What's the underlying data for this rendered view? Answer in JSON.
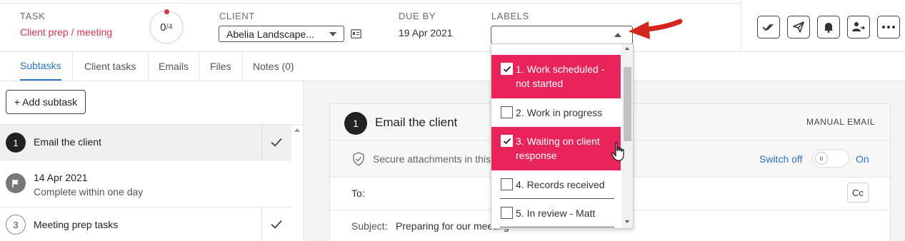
{
  "header": {
    "task_label": "TASK",
    "task_name": "Client prep / meeting",
    "progress_done": "0",
    "progress_total": "/4",
    "client_label": "CLIENT",
    "client_value": "Abelia Landscape...",
    "due_label": "DUE BY",
    "due_value": "19 Apr 2021",
    "labels_label": "LABELS"
  },
  "tabs": [
    {
      "label": "Subtasks",
      "active": true
    },
    {
      "label": "Client tasks"
    },
    {
      "label": "Emails"
    },
    {
      "label": "Files"
    },
    {
      "label": "Notes (0)"
    }
  ],
  "left": {
    "add_button": "+ Add subtask",
    "items": [
      {
        "num": "1",
        "title": "Email the client"
      },
      {
        "title": "14 Apr 2021",
        "desc": "Complete within one day"
      },
      {
        "num": "3",
        "title": "Meeting prep tasks"
      }
    ]
  },
  "right": {
    "step_num": "1",
    "title": "Email the client",
    "type": "MANUAL EMAIL",
    "secure_text": "Secure attachments in this",
    "switch_off": "Switch off",
    "switch_on": "On",
    "to_label": "To:",
    "cc": "Cc",
    "subject_label": "Subject:",
    "subject_value": "Preparing for our meeting"
  },
  "labels_dropdown": {
    "options": [
      {
        "label": "1. Work scheduled - not started",
        "checked": true
      },
      {
        "label": "2. Work in progress",
        "checked": false
      },
      {
        "label": "3. Waiting on client response",
        "checked": true
      },
      {
        "label": "4. Records received",
        "checked": false
      },
      {
        "label": "5. In review - Matt",
        "checked": false
      }
    ]
  },
  "colors": {
    "accent_blue": "#2b72c8",
    "selected_label": "#e8245a",
    "task_red": "#d6344a",
    "annotation_arrow": "#d4261c"
  }
}
